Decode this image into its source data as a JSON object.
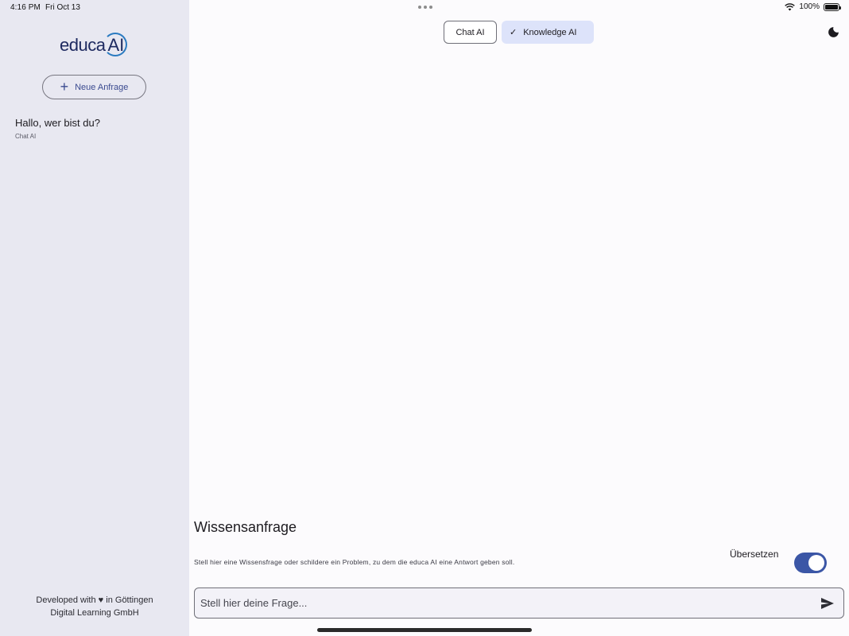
{
  "status_bar": {
    "time": "4:16 PM",
    "date": "Fri Oct 13",
    "battery": "100%"
  },
  "sidebar": {
    "logo_text": "educa",
    "logo_ai": "AI",
    "new_request_label": "Neue Anfrage",
    "history": [
      {
        "title": "Hallo, wer bist du?",
        "subtitle": "Chat AI"
      }
    ],
    "footer_line1_a": "Developed with",
    "footer_line1_b": "in Göttingen",
    "footer_line2": "Digital Learning GmbH"
  },
  "mode_switch": {
    "chat_label": "Chat AI",
    "knowledge_label": "Knowledge AI",
    "selected": "Knowledge AI"
  },
  "main": {
    "heading": "Wissensanfrage",
    "description": "Stell hier eine Wissensfrage oder schildere ein Problem, zu dem die educa AI eine Antwort geben soll.",
    "translate_label": "Übersetzen",
    "translate_on": true,
    "input_placeholder": "Stell hier deine Frage..."
  },
  "colors": {
    "accent": "#3b56a6",
    "sidebar_bg": "#e8e8f1",
    "selected_segment": "#dde3fa"
  }
}
